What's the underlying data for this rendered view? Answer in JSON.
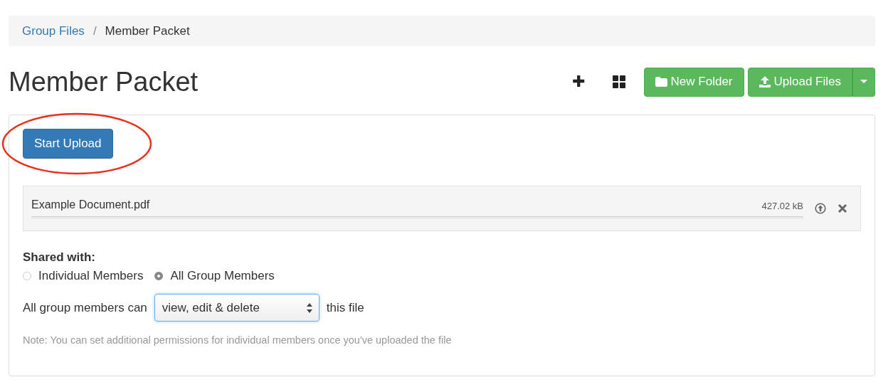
{
  "breadcrumb": [
    {
      "label": "Group Files"
    },
    {
      "label": "Member Packet"
    }
  ],
  "breadcrumb_separator": "/",
  "title": "Member Packet",
  "toolbar": {
    "add_icon": "✚",
    "new_folder": "New Folder",
    "upload_files": "Upload Files"
  },
  "start_upload": "Start Upload",
  "file": {
    "name": "Example Document.pdf",
    "size": "427.02 kB",
    "level": 0
  },
  "shared_with": {
    "label": "Shared with:",
    "options": [
      {
        "label": "Individual Members",
        "selected": false
      },
      {
        "label": "All Group Members",
        "selected": true
      }
    ]
  },
  "permission": {
    "prefix": "All group members can",
    "value": "view, edit & delete",
    "suffix": "this file"
  },
  "note": "Note: You can set additional permissions for individual members once you've uploaded the file"
}
